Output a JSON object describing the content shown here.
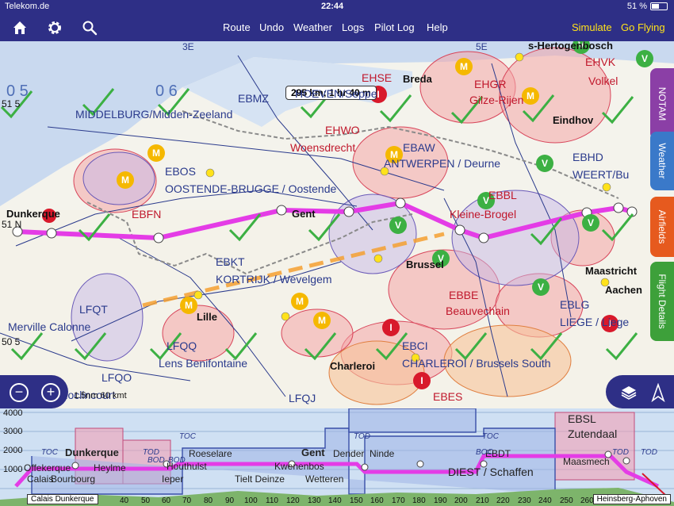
{
  "status": {
    "carrier": "Telekom.de",
    "time": "22:44",
    "battery": "51 %"
  },
  "toolbar": {
    "icons": [
      "home-icon",
      "gear-icon",
      "search-icon"
    ],
    "menu": [
      "Route",
      "Undo",
      "Weather",
      "Logs",
      "Pilot Log",
      "Help"
    ],
    "simulate": "Simulate",
    "go_flying": "Go Flying",
    "colors": {
      "bar": "#2e2f86",
      "accent": "#ffe21a"
    }
  },
  "map": {
    "distance_readout": "295 km; 1 hr 40 m",
    "grid_labels": [
      "3E",
      "5E",
      "0 5",
      "0 6",
      "51 5",
      "51 N",
      "50 5"
    ],
    "places": [
      {
        "id": "dunkerque",
        "text": "Dunkerque"
      },
      {
        "id": "breda",
        "text": "Breda"
      },
      {
        "id": "s-hertogenbosch",
        "text": "s-Hertogenbosch"
      },
      {
        "id": "eindhoven",
        "text": "Eindhov"
      },
      {
        "id": "brussel",
        "text": "Brussel"
      },
      {
        "id": "charleroi",
        "text": "Charleroi"
      },
      {
        "id": "lille",
        "text": "Lille"
      },
      {
        "id": "maastricht",
        "text": "Maastricht"
      },
      {
        "id": "aachen",
        "text": "Aachen"
      },
      {
        "id": "gent",
        "text": "Gent"
      },
      {
        "id": "woensdrecht",
        "text": "Woensdrecht"
      },
      {
        "id": "volkel",
        "text": "Volkel"
      },
      {
        "id": "kleine-brogel",
        "text": "Kleine-Brogel"
      },
      {
        "id": "ebbe-beauvechain",
        "text": "Beauvechain"
      }
    ],
    "airfields": [
      {
        "id": "ebos",
        "code": "EBOS",
        "name": "OOSTENDE-BRUGGE / Oostende"
      },
      {
        "id": "ebkt",
        "code": "EBKT",
        "name": "KORTRIJK / Wevelgem"
      },
      {
        "id": "ebmb",
        "code": "EBMZ",
        "name": "MIDDELBURG/Midden-Zeeland"
      },
      {
        "id": "ehse",
        "code": "EHSE",
        "name": "HOEVEN/Seppe"
      },
      {
        "id": "ehwo",
        "code": "EHWO",
        "name": ""
      },
      {
        "id": "ebaw",
        "code": "EBAW",
        "name": "ANTWERPEN / Deurne"
      },
      {
        "id": "ehgr",
        "code": "EHGR",
        "name": "Gilze-Rijen"
      },
      {
        "id": "ehvk",
        "code": "EHVK",
        "name": ""
      },
      {
        "id": "ebbl",
        "code": "EBBL",
        "name": ""
      },
      {
        "id": "ebbe",
        "code": "EBBE",
        "name": ""
      },
      {
        "id": "ebci",
        "code": "EBCI",
        "name": "CHARLEROI / Brussels South"
      },
      {
        "id": "eblg",
        "code": "EBLG",
        "name": "LIEGE / Liege"
      },
      {
        "id": "ebfn",
        "code": "EBFN",
        "name": ""
      },
      {
        "id": "ebes",
        "code": "EBES",
        "name": ""
      },
      {
        "id": "ebhd",
        "code": "EBHD",
        "name": "WEERT/Bu"
      },
      {
        "id": "lfqt",
        "code": "LFQT",
        "name": "Merville Calonne"
      },
      {
        "id": "lfqq",
        "code": "LFQQ",
        "name": "Lens Benifontaine"
      },
      {
        "id": "lfqj",
        "code": "LFQJ",
        "name": ""
      },
      {
        "id": "lfqo",
        "code": "LFQO",
        "name": "Arras Roclincourt"
      }
    ],
    "route_color": "#e43ce6",
    "tod_color": "#f5a030"
  },
  "sidetabs": [
    {
      "label": "NOTAM",
      "color": "#8b3fa6"
    },
    {
      "label": "Weather",
      "color": "#3a79c9"
    },
    {
      "label": "Airfields",
      "color": "#e65a1e"
    },
    {
      "label": "Flight Details",
      "color": "#3da03a"
    }
  ],
  "zoom": {
    "minus": "−",
    "plus": "+",
    "scale_text": "1.5nm 60 kmt"
  },
  "profile": {
    "altitudes": [
      "4000",
      "3000",
      "2000",
      "1000"
    ],
    "places": [
      "Dunkerque",
      "Roeselare",
      "Houthulst",
      "Kwenenbos",
      "Tielt Deinze",
      "Wetteren",
      "Gent",
      "Dender",
      "Ninde",
      "DIEST / Schaffen",
      "Maasmech",
      "EBDT",
      "EBSL",
      "Zutendaal",
      "Heylme",
      "Bourbourg",
      "Ieper",
      "Offekerque",
      "Calais"
    ],
    "markers": [
      "TOC",
      "TOD",
      "BOD",
      "TOC",
      "TOD",
      "BOC",
      "TOC",
      "TOD",
      "TOD",
      "BOD"
    ],
    "xticks": [
      "40",
      "50",
      "60",
      "70",
      "80",
      "90",
      "100",
      "110",
      "120",
      "130",
      "140",
      "150",
      "160",
      "170",
      "180",
      "190",
      "200",
      "210",
      "220",
      "230",
      "240",
      "250",
      "260"
    ],
    "start_label": "Calais Dunkerque",
    "end_label": "Heinsberg-Aphoven"
  }
}
